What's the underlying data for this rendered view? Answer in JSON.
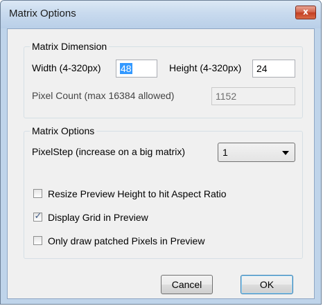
{
  "window": {
    "title": "Matrix Options",
    "close_glyph": "x"
  },
  "dimension_group": {
    "legend": "Matrix Dimension",
    "width_label": "Width (4-320px)",
    "width_value": "48",
    "height_label": "Height (4-320px)",
    "height_value": "24",
    "pixel_count_label": "Pixel Count (max 16384 allowed)",
    "pixel_count_value": "1152"
  },
  "options_group": {
    "legend": "Matrix Options",
    "pixelstep_label": "PixelStep (increase on a big matrix)",
    "pixelstep_value": "1",
    "checkboxes": [
      {
        "label": "Resize Preview Height to hit Aspect Ratio",
        "checked": false
      },
      {
        "label": "Display Grid in Preview",
        "checked": true
      },
      {
        "label": "Only draw patched Pixels in Preview",
        "checked": false
      }
    ]
  },
  "buttons": {
    "cancel": "Cancel",
    "ok": "OK"
  },
  "colors": {
    "frame": "#bfd4ea",
    "client_bg": "#f0f0f0",
    "selection": "#3399ff",
    "close_button": "#c94a2e"
  },
  "icons": {
    "close": "close-icon",
    "dropdown": "chevron-down-icon",
    "check": "checkmark-icon"
  }
}
